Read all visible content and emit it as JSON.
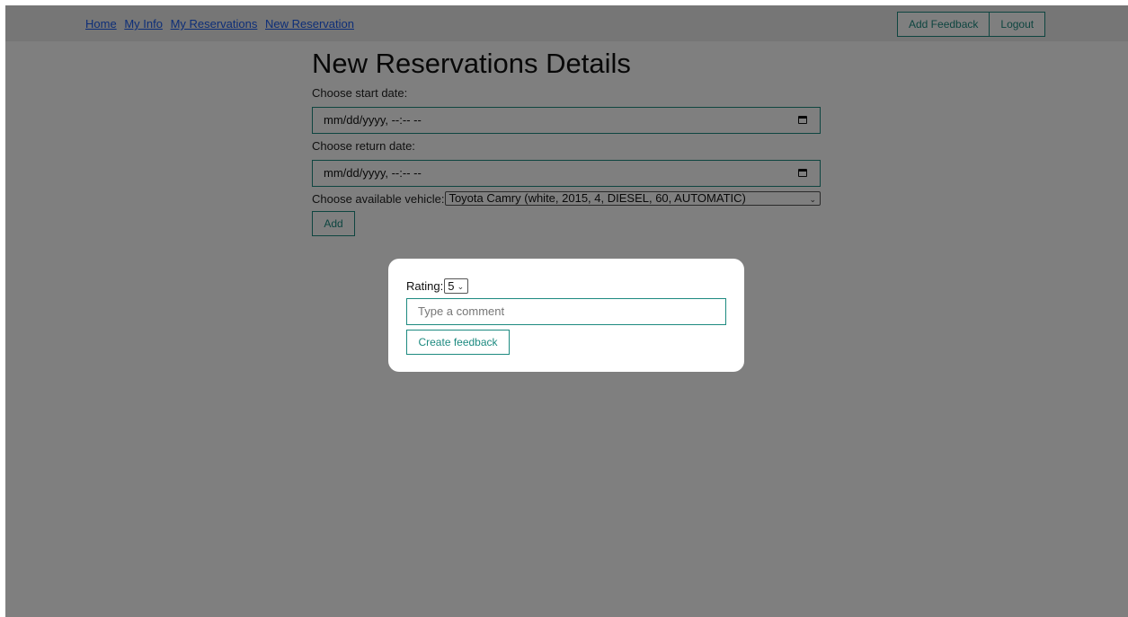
{
  "nav": {
    "links": [
      "Home",
      "My Info",
      "My Reservations",
      "New Reservation"
    ],
    "add_feedback_label": "Add Feedback",
    "logout_label": "Logout"
  },
  "main": {
    "title": "New Reservations Details",
    "start_label": "Choose start date:",
    "start_value": "mm/dd/yyyy, --:-- --",
    "return_label": "Choose return date:",
    "return_value": "mm/dd/yyyy, --:-- --",
    "vehicle_label": "Choose available vehicle:",
    "vehicle_value": "Toyota Camry (white, 2015, 4, DIESEL, 60, AUTOMATIC)",
    "add_label": "Add"
  },
  "modal": {
    "rating_label": "Rating:",
    "rating_value": "5",
    "comment_placeholder": "Type a comment",
    "create_label": "Create feedback"
  },
  "colors": {
    "accent": "#1d8a80",
    "link": "#1a5cf0",
    "overlay": "rgba(0,0,0,0.5)"
  }
}
